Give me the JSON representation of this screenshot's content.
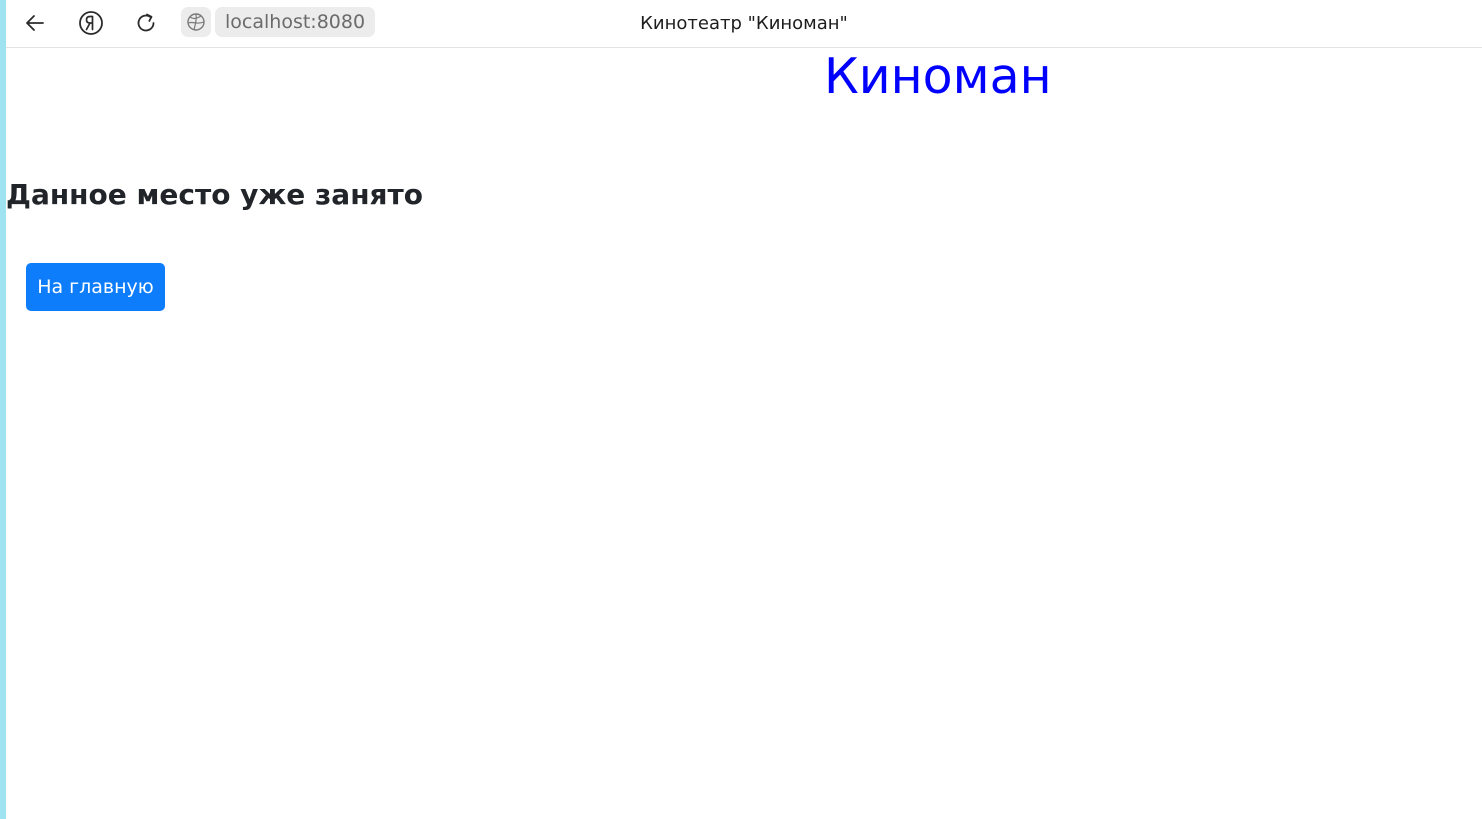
{
  "browser": {
    "back_icon": "arrow-left-icon",
    "yandex_icon": "yandex-logo-icon",
    "reload_icon": "reload-icon",
    "site_icon": "globe-icon",
    "url": "localhost:8080",
    "tab_title": "Кинотеатр \"Киноман\""
  },
  "page": {
    "brand": "Киноман",
    "brand_color": "#0000ff",
    "message": "Данное место уже занято",
    "home_button_label": "На главную",
    "accent_color": "#0d7dfb"
  }
}
